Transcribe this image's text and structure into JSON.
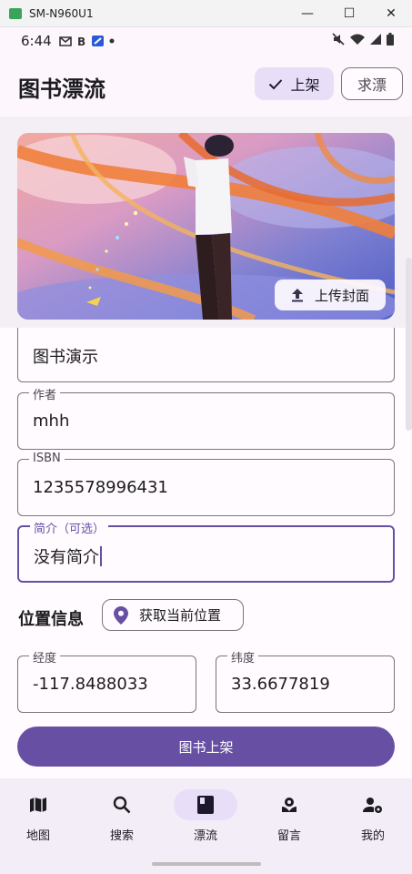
{
  "window": {
    "title": "SM-N960U1",
    "minimize": "—",
    "maximize": "☐",
    "close": "✕"
  },
  "status_bar": {
    "time": "6:44"
  },
  "app_bar": {
    "title": "图书漂流",
    "shelve_label": "上架",
    "request_label": "求漂"
  },
  "cover": {
    "upload_label": "上传封面"
  },
  "form": {
    "title_value": "图书演示",
    "author": {
      "label": "作者",
      "value": "mhh"
    },
    "isbn": {
      "label": "ISBN",
      "value": "1235578996431"
    },
    "intro": {
      "label": "简介（可选）",
      "value": "没有简介"
    },
    "location_label": "位置信息",
    "get_location_label": "获取当前位置",
    "longitude": {
      "label": "经度",
      "value": "-117.8488033"
    },
    "latitude": {
      "label": "纬度",
      "value": "33.6677819"
    },
    "submit_label": "图书上架"
  },
  "nav": {
    "items": [
      {
        "label": "地图",
        "icon": "map-icon"
      },
      {
        "label": "搜索",
        "icon": "search-icon"
      },
      {
        "label": "漂流",
        "icon": "book-icon",
        "active": true
      },
      {
        "label": "留言",
        "icon": "message-icon"
      },
      {
        "label": "我的",
        "icon": "account-icon"
      }
    ]
  },
  "colors": {
    "primary": "#6750a4",
    "secondary_container": "#e8def8",
    "outline": "#79747e"
  }
}
